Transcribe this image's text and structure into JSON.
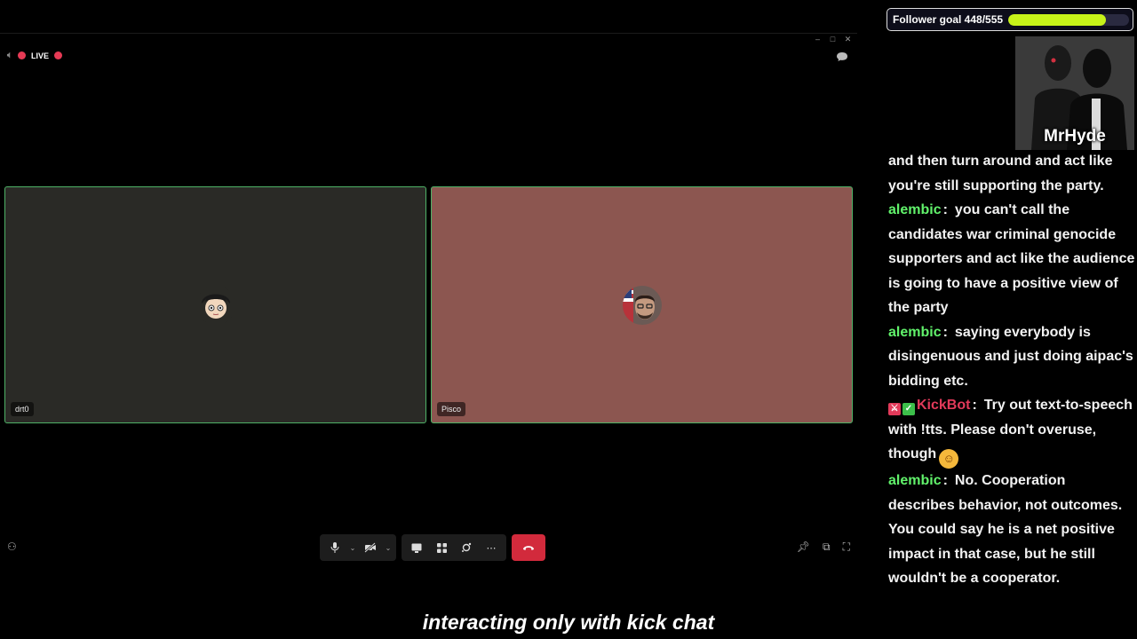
{
  "call": {
    "live_label": "LIVE",
    "participants": [
      {
        "name": "drt0"
      },
      {
        "name": "Pisco"
      }
    ]
  },
  "overlay": {
    "follower_goal": {
      "label": "Follower goal 448/555",
      "current": 448,
      "target": 555,
      "accent": "#c7f219"
    },
    "webcam_name": "MrHyde"
  },
  "chat": {
    "partial_first": "and then turn around and act like you're still supporting the party.",
    "messages": [
      {
        "user": "alembic",
        "text": "you can't call the candidates war criminal genocide supporters and act like the audience is going to have a positive view of the party"
      },
      {
        "user": "alembic",
        "text": "saying everybody is disingenuous and just doing aipac's bidding etc."
      },
      {
        "user": "KickBot",
        "text": "Try out text-to-speech with !tts. Please don't overuse, though",
        "bot": true
      },
      {
        "user": "alembic",
        "text": "No. Cooperation describes behavior, not outcomes. You could say he is a net positive impact in that case, but he still wouldn't be a cooperator."
      }
    ],
    "user_color": "#61f26b",
    "bot_color": "#e23a5a"
  },
  "caption": "interacting only with kick chat",
  "icons": [
    "speaker-icon",
    "chat-bubble-icon",
    "mic-icon",
    "camera-off-icon",
    "share-screen-icon",
    "grid-icon",
    "effects-icon",
    "more-icon",
    "end-call-icon",
    "participants-icon",
    "pin-icon",
    "popout-icon",
    "fullscreen-icon"
  ]
}
